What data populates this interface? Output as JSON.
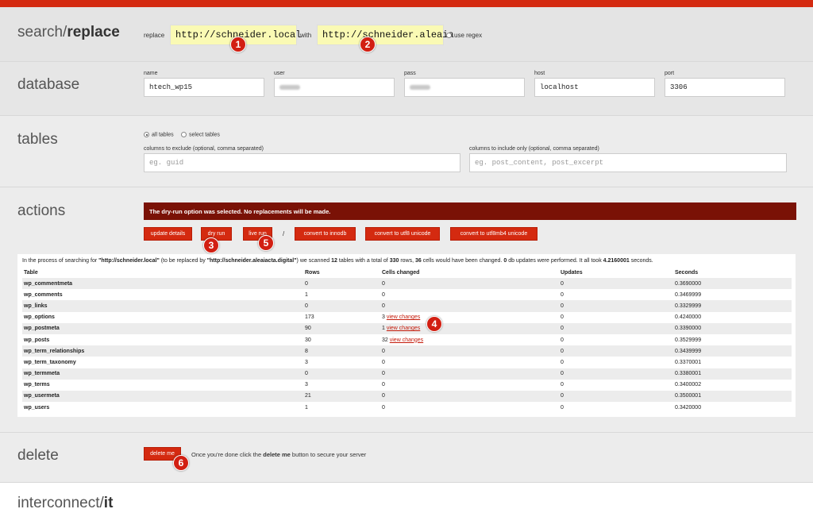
{
  "search_replace": {
    "title_plain": "search/",
    "title_bold": "replace",
    "replace_label": "replace",
    "replace_value": "http://schneider.local",
    "with_label": "with",
    "with_value": "http://schneider.aleaia",
    "regex_label": "use regex"
  },
  "database": {
    "title": "database",
    "name_label": "name",
    "name_value": "htech_wp15",
    "user_label": "user",
    "pass_label": "pass",
    "host_label": "host",
    "host_value": "localhost",
    "port_label": "port",
    "port_value": "3306"
  },
  "tables": {
    "title": "tables",
    "all_tables": "all tables",
    "select_tables": "select tables",
    "exclude_label": "columns to exclude (optional, comma separated)",
    "exclude_placeholder": "eg. guid",
    "include_label": "columns to include only (optional, comma separated)",
    "include_placeholder": "eg. post_content, post_excerpt"
  },
  "actions": {
    "title": "actions",
    "alert": "The dry-run option was selected. No replacements will be made.",
    "buttons": {
      "update": "update details",
      "dry": "dry run",
      "live": "live run",
      "sep": "/",
      "innodb": "convert to innodb",
      "utf8": "convert to utf8 unicode",
      "utf8mb4": "convert to utf8mb4 unicode"
    }
  },
  "results": {
    "s1": "In the process of searching for ",
    "search": "\"http://schneider.local\"",
    "s2": " (to be replaced by ",
    "replace": "\"http://schneider.aleaiacta.digital\"",
    "s3": ") we scanned ",
    "tables_count": "12",
    "s4": " tables with a total of ",
    "rows_count": "330",
    "s5": " rows, ",
    "cells_count": "36",
    "s6": " cells would have been changed. ",
    "updates_count": "0",
    "s7": " db updates were performed. It all took ",
    "time": "4.2160001",
    "s8": " seconds.",
    "headers": {
      "table": "Table",
      "rows": "Rows",
      "cells": "Cells changed",
      "updates": "Updates",
      "seconds": "Seconds"
    },
    "view_changes": "view changes",
    "rows": [
      {
        "table": "wp_commentmeta",
        "rows": "0",
        "cells": "0",
        "link": false,
        "updates": "0",
        "seconds": "0.3690000"
      },
      {
        "table": "wp_comments",
        "rows": "1",
        "cells": "0",
        "link": false,
        "updates": "0",
        "seconds": "0.3469999"
      },
      {
        "table": "wp_links",
        "rows": "0",
        "cells": "0",
        "link": false,
        "updates": "0",
        "seconds": "0.3329999"
      },
      {
        "table": "wp_options",
        "rows": "173",
        "cells": "3",
        "link": true,
        "updates": "0",
        "seconds": "0.4240000"
      },
      {
        "table": "wp_postmeta",
        "rows": "90",
        "cells": "1",
        "link": true,
        "updates": "0",
        "seconds": "0.3390000"
      },
      {
        "table": "wp_posts",
        "rows": "30",
        "cells": "32",
        "link": true,
        "updates": "0",
        "seconds": "0.3529999"
      },
      {
        "table": "wp_term_relationships",
        "rows": "8",
        "cells": "0",
        "link": false,
        "updates": "0",
        "seconds": "0.3439999"
      },
      {
        "table": "wp_term_taxonomy",
        "rows": "3",
        "cells": "0",
        "link": false,
        "updates": "0",
        "seconds": "0.3370001"
      },
      {
        "table": "wp_termmeta",
        "rows": "0",
        "cells": "0",
        "link": false,
        "updates": "0",
        "seconds": "0.3380001"
      },
      {
        "table": "wp_terms",
        "rows": "3",
        "cells": "0",
        "link": false,
        "updates": "0",
        "seconds": "0.3400002"
      },
      {
        "table": "wp_usermeta",
        "rows": "21",
        "cells": "0",
        "link": false,
        "updates": "0",
        "seconds": "0.3500001"
      },
      {
        "table": "wp_users",
        "rows": "1",
        "cells": "0",
        "link": false,
        "updates": "0",
        "seconds": "0.3420000"
      }
    ]
  },
  "delete": {
    "title": "delete",
    "button": "delete me",
    "t1": "Once you're done click the ",
    "t_bold": "delete me",
    "t2": " button to secure your server"
  },
  "footer": {
    "brand_plain": "interconnect/",
    "brand_bold": "it"
  },
  "markers": [
    "1",
    "2",
    "3",
    "4",
    "5",
    "6"
  ],
  "colors": {
    "accent": "#d42a10",
    "alert_bg": "#7a1206",
    "marker": "#d21f12",
    "highlight": "#fafab4"
  }
}
